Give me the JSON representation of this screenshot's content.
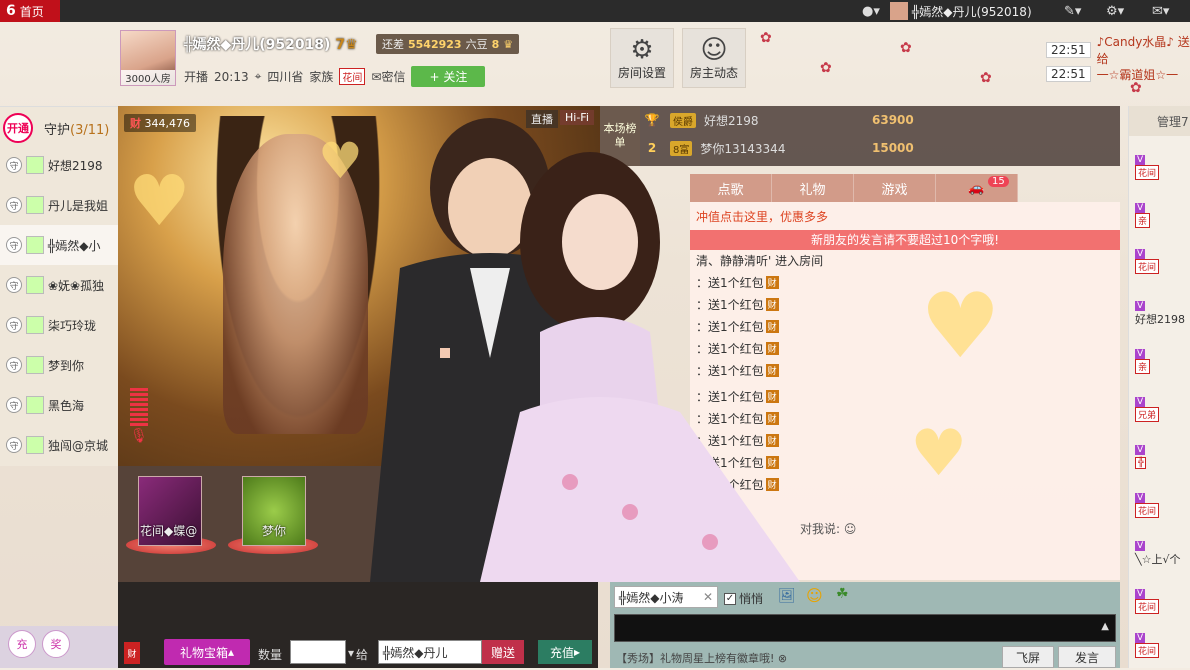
{
  "topbar": {
    "home_label": "首页",
    "username": "╬嫣然◆丹儿(952018)"
  },
  "header": {
    "avatar_caption": "3000人房",
    "anchor_name": "╬嫣然◆丹儿(952018)",
    "anchor_level": "7",
    "bean_prefix": "还差",
    "bean_value": "5542923",
    "bean_suffix": "六豆",
    "bean_level": "8",
    "live_label": "开播",
    "live_time": "20:13",
    "location": "四川省",
    "family_label": "家族",
    "family_tag": "花间",
    "private_msg": "密信",
    "follow_label": "+ 关注",
    "room_settings": "房间设置",
    "host_news": "房主动态"
  },
  "notices": [
    {
      "time": "22:51",
      "text": "♪Candy水晶♪ 送给"
    },
    {
      "time": "22:51",
      "text": "一☆霸道姐☆一"
    }
  ],
  "guard": {
    "open_label": "开通",
    "title": "守护",
    "count": "(3/11)",
    "badge": "守",
    "items": [
      "好想2198",
      "丹儿是我姐",
      "╬嫣然◆小",
      "❀妩❀孤独",
      "柒巧玲珑",
      "梦到你",
      "黑色海",
      "独闯@京城"
    ]
  },
  "video": {
    "fans_value": "344,476",
    "live_tag": "直播",
    "hifi_tag": "Hi-Fi"
  },
  "rank": {
    "tab_label": "本场榜单",
    "rows": [
      {
        "rank": "1",
        "badge": "侯爵",
        "name": "好想2198",
        "score": "63900"
      },
      {
        "rank": "2",
        "badge": "8富",
        "name": "梦你13143344",
        "score": "15000"
      }
    ]
  },
  "tabs": [
    "点歌",
    "礼物",
    "游戏",
    "座驾"
  ],
  "tab_car_count": "15",
  "chat": {
    "promo": "冲值点击这里，优惠多多",
    "notice": "新朋友的发言请不要超过10个字哦!",
    "enter": "清、静静清听' 进入房间",
    "gift_line": "：送1个红包",
    "gift_badge": "财",
    "say_to": "对我说:"
  },
  "users": {
    "head": "管理7",
    "rows": [
      "花间",
      "亲",
      "花间",
      "好想2198",
      "亲",
      "兄弟",
      "╬",
      "花间",
      "╲☆上√个",
      "花间",
      "花间"
    ]
  },
  "stage": {
    "seat1": "花间◆蝶@",
    "seat2": "梦你"
  },
  "bottom": {
    "gift_box": "礼物宝箱",
    "qty_label": "数量",
    "to_label": "给",
    "to_value": "╬嫣然◆丹儿",
    "give_label": "赠送",
    "recharge_label": "充值"
  },
  "chat_bottom": {
    "target": "╬嫣然◆小涛",
    "private_label": "悄悄",
    "marquee": "【秀场】礼物周星上榜有徽章哦!",
    "fly_label": "飞屏",
    "send_label": "发言"
  },
  "left_bottom": {
    "recharge": "充",
    "reward": "奖"
  },
  "colors": {
    "accent": "#c0101a",
    "follow": "#5cb84a",
    "gift": "#c02ab0",
    "recharge": "#2c7d62"
  }
}
